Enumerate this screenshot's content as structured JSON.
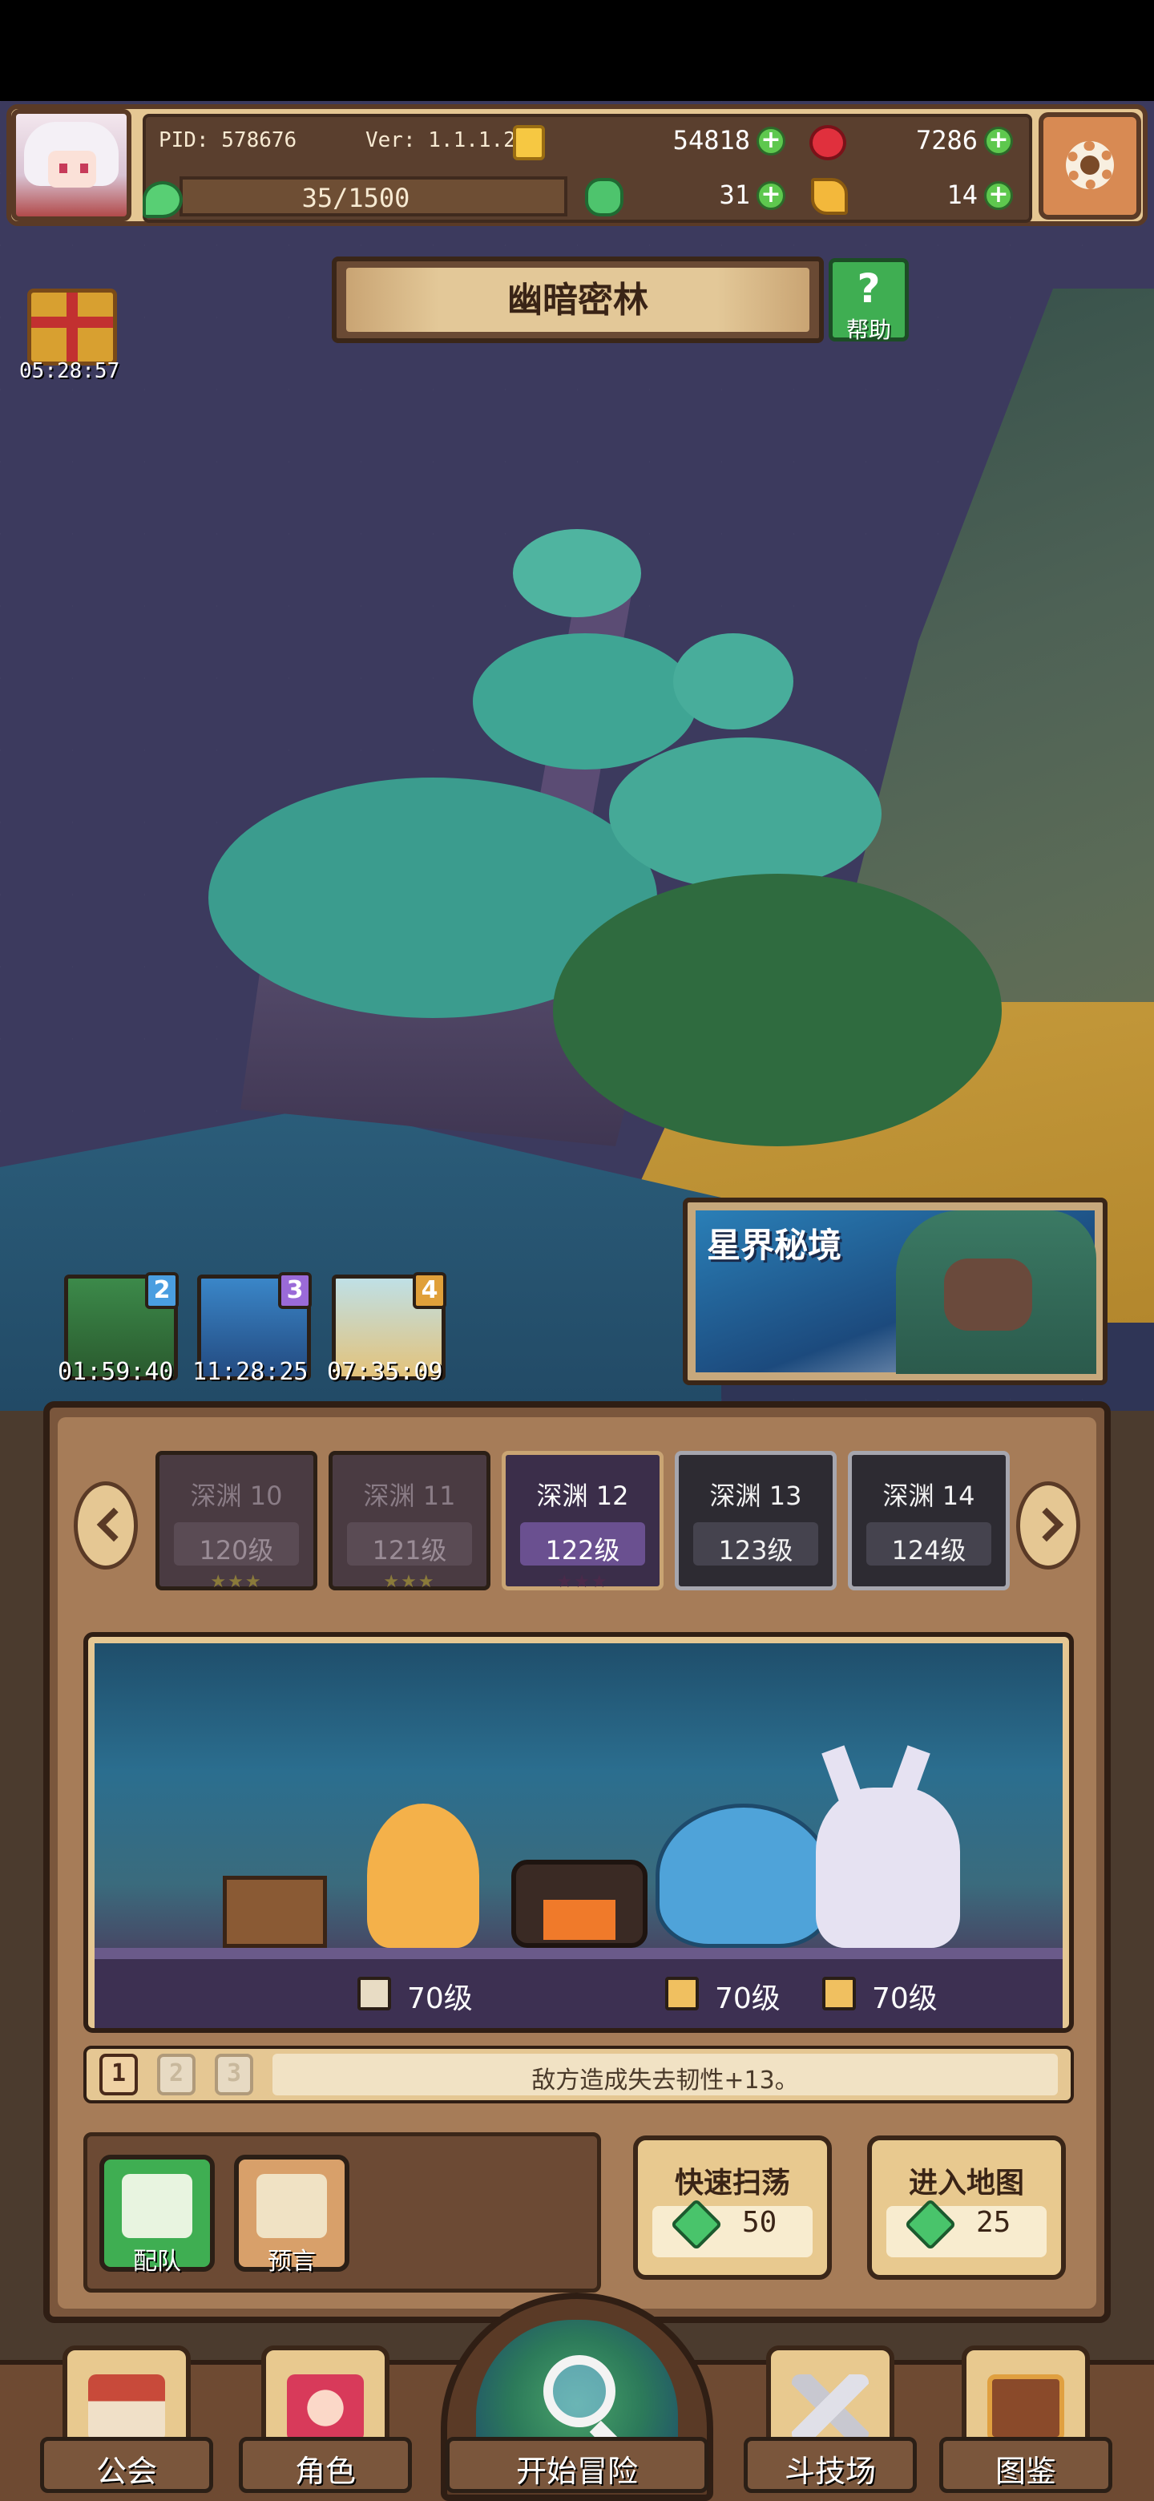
{
  "hud": {
    "pid": "PID: 578676",
    "version": "Ver: 1.1.1.2",
    "gold": "54818",
    "ruby": "7286",
    "stamina": "35/1500",
    "clover": "31",
    "keys": "14",
    "plus_symbol": "+"
  },
  "gift": {
    "timer": "05:28:57"
  },
  "map": {
    "title": "幽暗密林",
    "help_q": "?",
    "help_label": "帮助"
  },
  "portals": [
    {
      "badge": "2",
      "timer": "01:59:40"
    },
    {
      "badge": "3",
      "timer": "11:28:25"
    },
    {
      "badge": "4",
      "timer": "07:35:09"
    }
  ],
  "astral": {
    "title": "星界秘境"
  },
  "stages": [
    {
      "name": "深渊 10",
      "level": "120级",
      "stars": "★★★"
    },
    {
      "name": "深渊 11",
      "level": "121级",
      "stars": "★★★"
    },
    {
      "name": "深渊 12",
      "level": "122级",
      "stars": "★★★"
    },
    {
      "name": "深渊 13",
      "level": "123级"
    },
    {
      "name": "深渊 14",
      "level": "124级"
    }
  ],
  "enemy_levels": {
    "shield": "70级",
    "sword": "70级",
    "bow": "70级"
  },
  "buff": {
    "tabs": [
      "1",
      "2",
      "3"
    ],
    "text": "敌方造成失去韧性+13。"
  },
  "buttons": {
    "team": "配队",
    "prophecy": "预言",
    "sweep_label": "快速扫荡",
    "sweep_cost": "50",
    "enter_label": "进入地图",
    "enter_cost": "25"
  },
  "nav": {
    "guild": "公会",
    "character": "角色",
    "adventure": "开始冒险",
    "arena": "斗技场",
    "codex": "图鉴"
  },
  "colors": {
    "hud_bg": "#e5c793",
    "panel_brown": "#7a563c",
    "accent_green": "#5ec84e",
    "current_stage": "#6a5090"
  }
}
